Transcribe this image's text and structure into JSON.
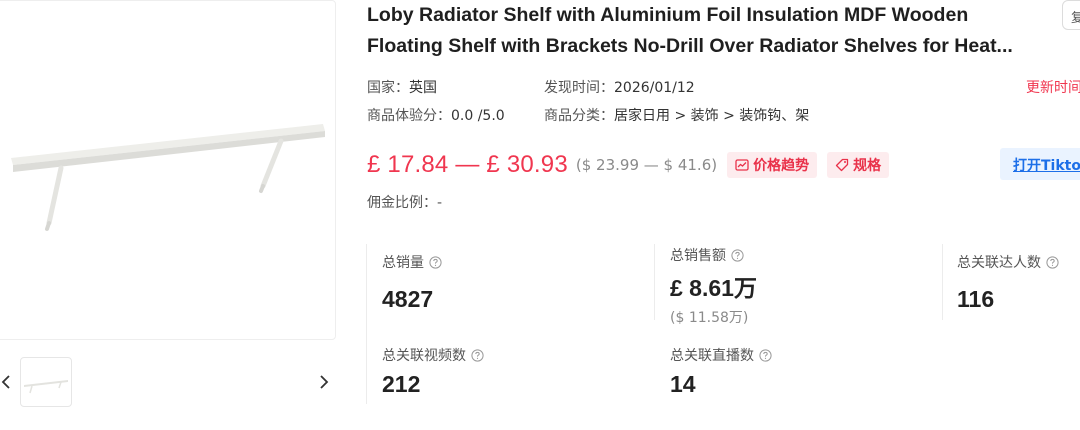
{
  "product": {
    "title_line1": "Loby Radiator Shelf with Aluminium Foil Insulation MDF Wooden",
    "title_line2": "Floating Shelf with Brackets No-Drill Over Radiator Shelves for Heat...",
    "corner_chip_text": "复"
  },
  "meta": {
    "country_label": "国家：",
    "country_value": "英国",
    "found_label": "发现时间：",
    "found_value": "2026/01/12",
    "rating_label": "商品体验分：",
    "rating_value": "0.0 /5.0",
    "category_label": "商品分类：",
    "category_value": "居家日用 > 装饰 > 装饰钩、架",
    "update_link": "更新时间"
  },
  "price": {
    "main": "£ 17.84 — £ 30.93",
    "usd": "($ 23.99 — $ 41.6)",
    "trend_label": "价格趋势",
    "spec_label": "规格",
    "tiktok_label": "打开Tiktok"
  },
  "commission": {
    "label": "佣金比例：",
    "value": "-"
  },
  "stats": {
    "total_sales": {
      "label": "总销量",
      "value": "4827"
    },
    "total_revenue": {
      "label": "总销售额",
      "value": "£ 8.61万",
      "sub": "($ 11.58万)"
    },
    "influencers": {
      "label": "总关联达人数",
      "value": "116"
    },
    "videos": {
      "label": "总关联视频数",
      "value": "212"
    },
    "livestreams": {
      "label": "总关联直播数",
      "value": "14"
    }
  },
  "icons": {
    "help": "question-circle-icon",
    "trend": "chart-icon",
    "spec": "tag-icon",
    "prev": "chevron-left-icon",
    "next": "chevron-right-icon"
  },
  "colors": {
    "price_red": "#f0364f",
    "tag_bg": "#fdecee",
    "link_blue": "#1d6fe8",
    "button_bg": "#eaf3ff"
  }
}
